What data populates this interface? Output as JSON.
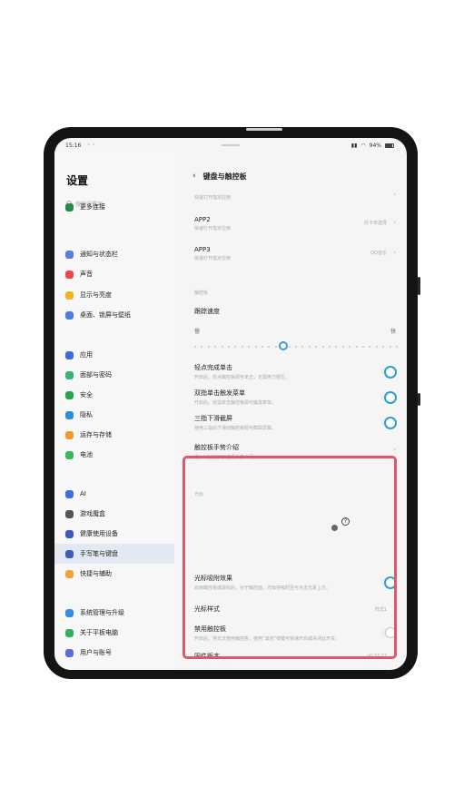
{
  "status": {
    "time": "15:16",
    "battery": "94%"
  },
  "sidebar": {
    "title": "设置",
    "search_placeholder": "搜索设置项",
    "items": [
      {
        "label": "更多连接",
        "icon": "link-icon",
        "color": "#2a8a4a"
      },
      {
        "label": "通知与状态栏",
        "icon": "notification-icon",
        "color": "#5a7fd6"
      },
      {
        "label": "声音",
        "icon": "sound-icon",
        "color": "#e74a4a"
      },
      {
        "label": "显示与亮度",
        "icon": "brightness-icon",
        "color": "#f0b323"
      },
      {
        "label": "桌面、锁屏与壁纸",
        "icon": "wallpaper-icon",
        "color": "#4a7de0"
      },
      {
        "label": "应用",
        "icon": "apps-icon",
        "color": "#3b6fd8"
      },
      {
        "label": "面部与密码",
        "icon": "face-icon",
        "color": "#3bb07a"
      },
      {
        "label": "安全",
        "icon": "security-icon",
        "color": "#2ea24a"
      },
      {
        "label": "隐私",
        "icon": "privacy-icon",
        "color": "#2b8fd6"
      },
      {
        "label": "运存与存储",
        "icon": "storage-icon",
        "color": "#f29a2e"
      },
      {
        "label": "电池",
        "icon": "battery-icon",
        "color": "#3cb75a"
      },
      {
        "label": "AI",
        "icon": "ai-icon",
        "color": "#3f6fe0"
      },
      {
        "label": "游戏魔盒",
        "icon": "game-icon",
        "color": "#555555"
      },
      {
        "label": "健康使用设备",
        "icon": "hourglass-icon",
        "color": "#3d5ab5"
      },
      {
        "label": "手写笔与键盘",
        "icon": "pen-icon",
        "color": "#3d5ab5"
      },
      {
        "label": "快捷与辅助",
        "icon": "shortcut-icon",
        "color": "#f2a23a"
      },
      {
        "label": "系统管理与升级",
        "icon": "system-icon",
        "color": "#3a8ce0"
      },
      {
        "label": "关于平板电脑",
        "icon": "info-icon",
        "color": "#2fb05a"
      },
      {
        "label": "用户与账号",
        "icon": "user-icon",
        "color": "#5a6fd6"
      }
    ]
  },
  "main": {
    "title": "键盘与触控板",
    "top_desc": "快速打开指定应用",
    "app2": {
      "label": "APP2",
      "desc": "快速打开指定应用",
      "value": "抖卡未选择"
    },
    "app3": {
      "label": "APP3",
      "desc": "快速打开指定应用",
      "value": "QQ音乐"
    },
    "touchpad_section": "触控板",
    "tracking_speed": "跟踪速度",
    "slow": "慢",
    "fast": "快",
    "tracking_speed_level": 0.44,
    "toggles": [
      {
        "label": "轻点完成单击",
        "desc": "开启后，轻点触控板即可单击，无需用力按压。",
        "on": true
      },
      {
        "label": "双指单击触发菜单",
        "desc": "开启后，双指单击触控板即可触发菜单。",
        "on": true
      },
      {
        "label": "三指下滑截屏",
        "desc": "使用三指向下滑动触控板即可截取屏幕。",
        "on": true
      }
    ],
    "gesture_intro": {
      "label": "触控板手势介绍",
      "desc": "进入“使用技巧”查看手势介绍"
    },
    "cursor_section": "光标",
    "cursor_magnet": {
      "label": "光标吸附效果",
      "desc": "启用触控板或鼠标后，对于触控面，光标将吸附至可点击元素上方。",
      "on": true
    },
    "cursor_style": {
      "label": "光标样式",
      "value": "样式1"
    },
    "disable_touchpad": {
      "label": "禁用触控板",
      "desc": "开启后，将无法使用触控板，使用“其他”按键可快速开启或关闭此开关。",
      "on": false
    },
    "firmware": {
      "label": "固件版本",
      "value": "v0.37.27"
    }
  }
}
